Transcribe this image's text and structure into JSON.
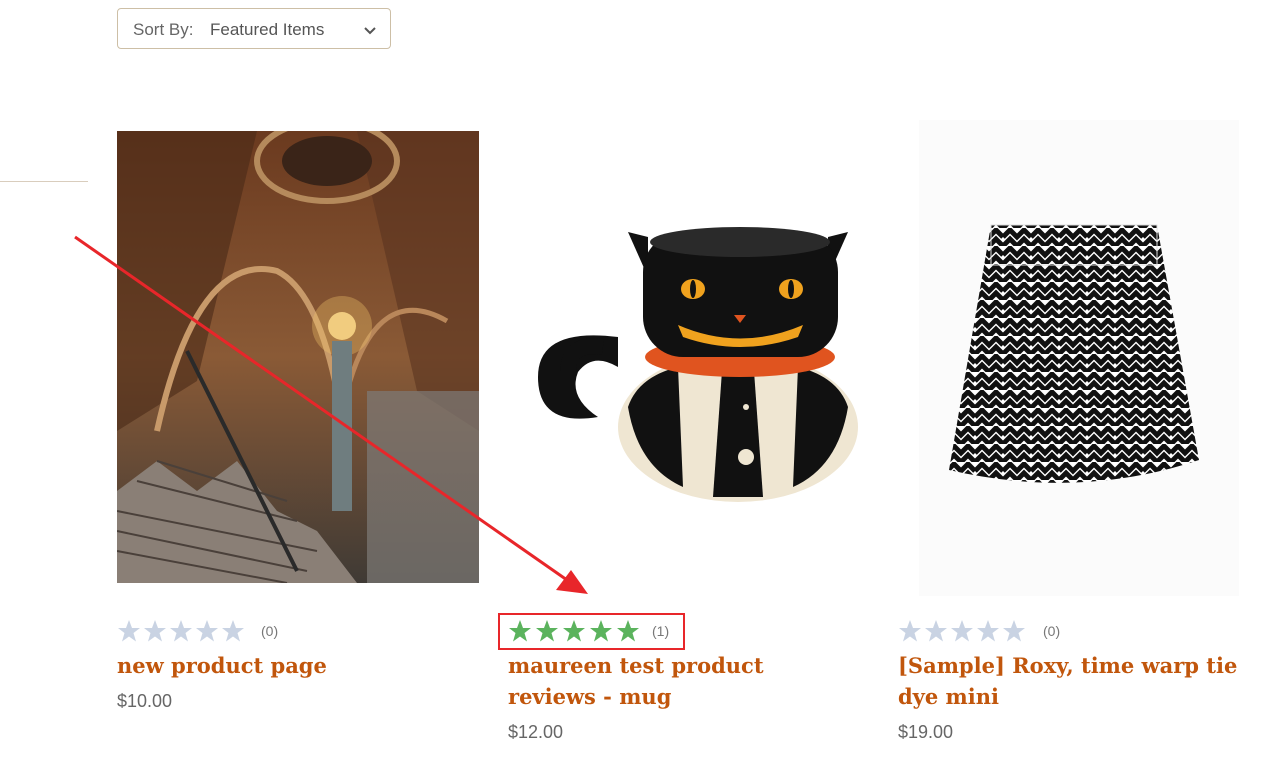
{
  "sort": {
    "label": "Sort By:",
    "value": "Featured Items"
  },
  "products": [
    {
      "title": "new product page",
      "price": "$10.00",
      "rating_count": "(0)",
      "stars_filled": 0,
      "image_desc": "cathedral staircase"
    },
    {
      "title": "maureen test product reviews - mug",
      "price": "$12.00",
      "rating_count": "(1)",
      "stars_filled": 5,
      "image_desc": "black cat pumpkin mug"
    },
    {
      "title": "[Sample] Roxy, time warp tie dye mini",
      "price": "$19.00",
      "rating_count": "(0)",
      "stars_filled": 0,
      "image_desc": "chevron print skirt"
    }
  ],
  "colors": {
    "accent": "#c1560c",
    "star_filled": "#5bb35d",
    "star_empty": "#c9d3e3",
    "annotation": "#e8262a"
  }
}
